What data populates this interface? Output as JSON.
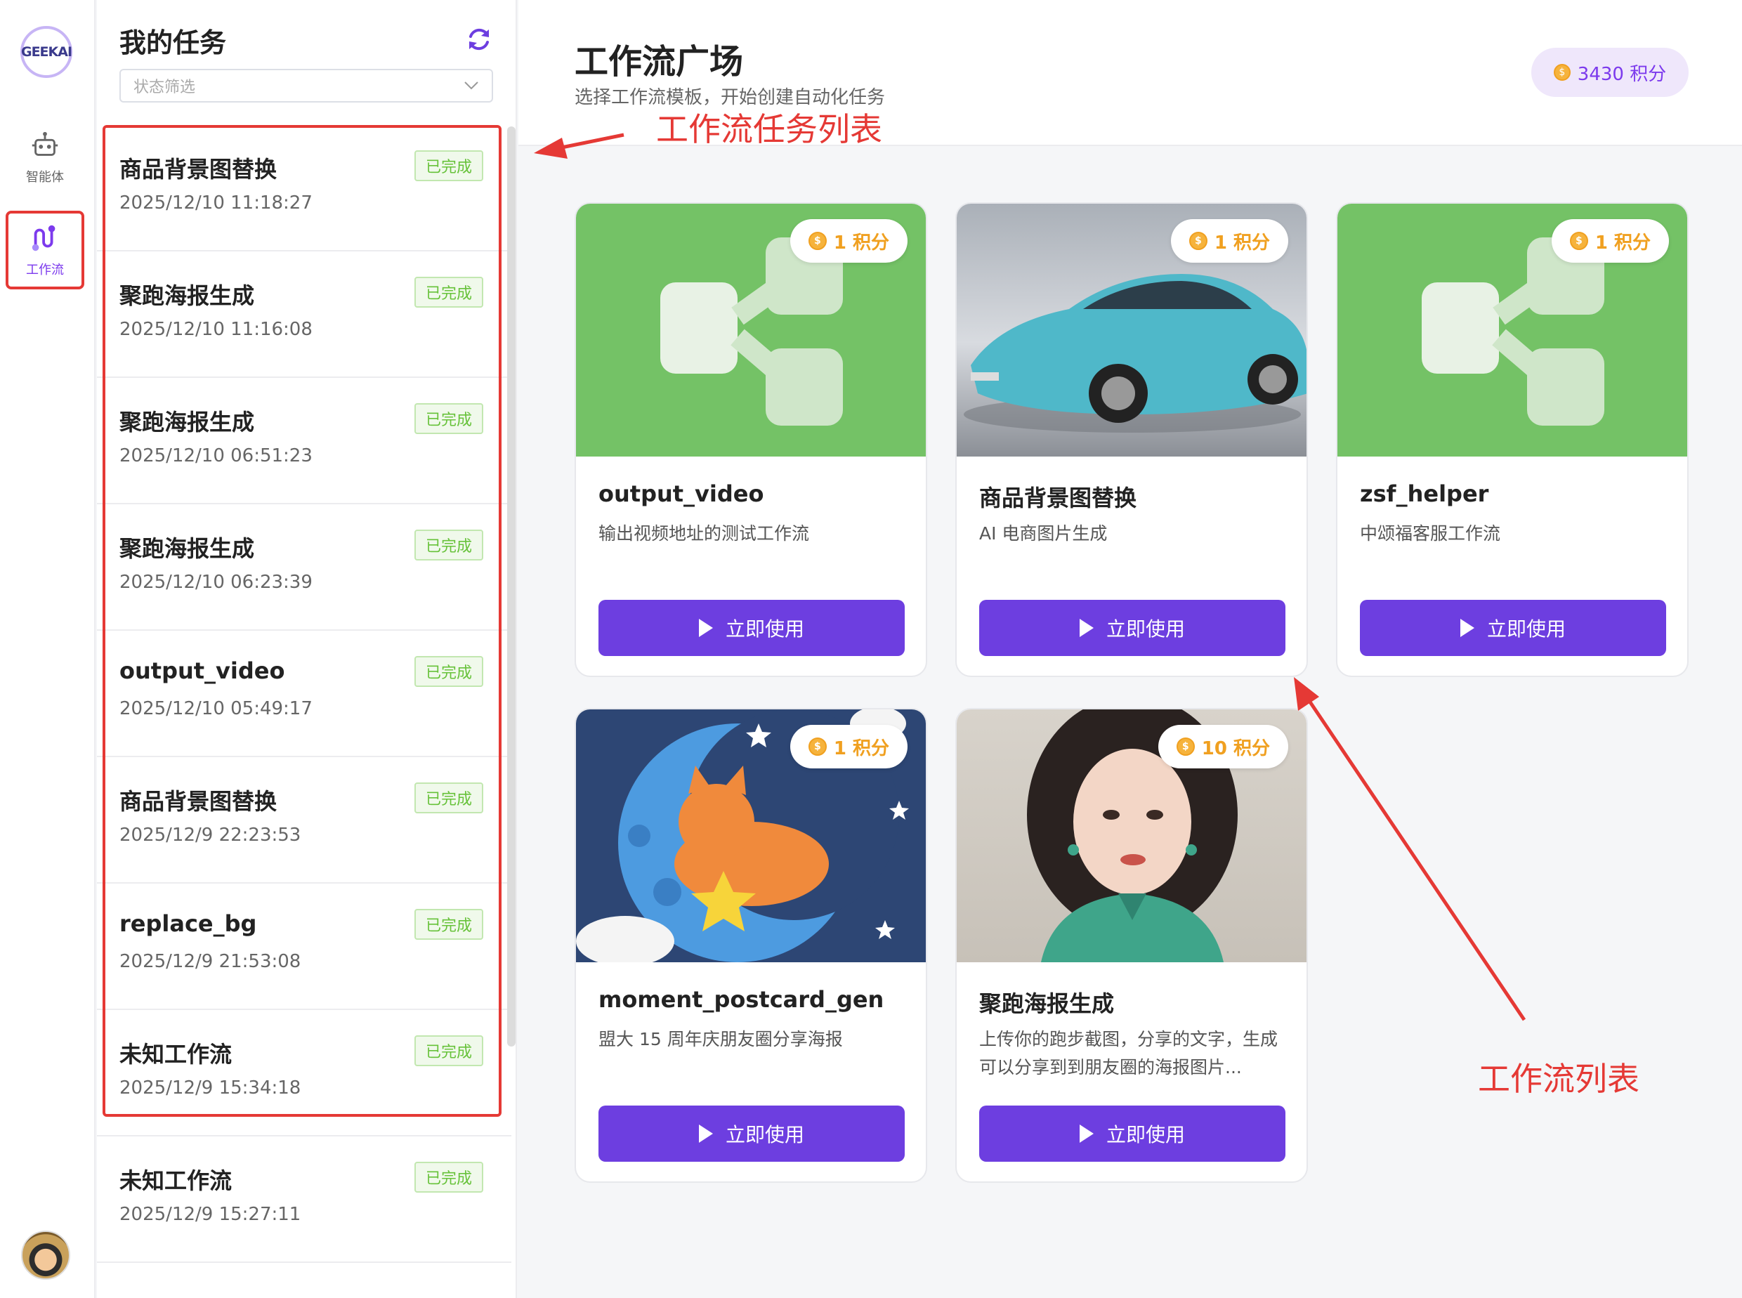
{
  "rail": {
    "logo_text": "GEEKAI",
    "items": [
      {
        "label": "智能体",
        "icon": "robot-icon"
      },
      {
        "label": "工作流",
        "icon": "workflow-icon"
      }
    ]
  },
  "tasks": {
    "title": "我的任务",
    "filter_placeholder": "状态筛选",
    "items": [
      {
        "name": "商品背景图替换",
        "time": "2025/12/10 11:18:27",
        "status": "已完成"
      },
      {
        "name": "聚跑海报生成",
        "time": "2025/12/10 11:16:08",
        "status": "已完成"
      },
      {
        "name": "聚跑海报生成",
        "time": "2025/12/10 06:51:23",
        "status": "已完成"
      },
      {
        "name": "聚跑海报生成",
        "time": "2025/12/10 06:23:39",
        "status": "已完成"
      },
      {
        "name": "output_video",
        "time": "2025/12/10 05:49:17",
        "status": "已完成"
      },
      {
        "name": "商品背景图替换",
        "time": "2025/12/9 22:23:53",
        "status": "已完成"
      },
      {
        "name": "replace_bg",
        "time": "2025/12/9 21:53:08",
        "status": "已完成"
      },
      {
        "name": "未知工作流",
        "time": "2025/12/9 15:34:18",
        "status": "已完成"
      },
      {
        "name": "未知工作流",
        "time": "2025/12/9 15:27:11",
        "status": "已完成"
      }
    ]
  },
  "header": {
    "title": "工作流广场",
    "subtitle": "选择工作流模板，开始创建自动化任务",
    "points": "3430 积分"
  },
  "cards": [
    {
      "name": "output_video",
      "desc": "输出视频地址的测试工作流",
      "price": "1 积分",
      "button": "立即使用"
    },
    {
      "name": "商品背景图替换",
      "desc": "AI 电商图片生成",
      "price": "1 积分",
      "button": "立即使用"
    },
    {
      "name": "zsf_helper",
      "desc": "中颂福客服工作流",
      "price": "1 积分",
      "button": "立即使用"
    },
    {
      "name": "moment_postcard_gen",
      "desc": "盟大 15 周年庆朋友圈分享海报",
      "price": "1 积分",
      "button": "立即使用"
    },
    {
      "name": "聚跑海报生成",
      "desc": "上传你的跑步截图，分享的文字，生成可以分享到到朋友圈的海报图片...",
      "price": "10 积分",
      "button": "立即使用"
    }
  ],
  "annotations": {
    "task_list": "工作流任务列表",
    "workflow_list": "工作流列表"
  },
  "colors": {
    "accent": "#6d3ee0",
    "annotation": "#e53935",
    "success": "#67c23a",
    "coin": "#f0a020"
  }
}
